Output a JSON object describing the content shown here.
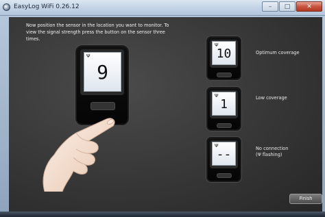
{
  "window": {
    "title": "EasyLog WiFi 0.26.12",
    "controls": {
      "minimize": "–",
      "maximize": "□",
      "close": "✕"
    }
  },
  "instructions": "Now position the sensor in the location you want to monitor. To view the signal strength press the button on the sensor three times.",
  "main_device": {
    "antenna_icon": "antenna-icon",
    "reading": "9"
  },
  "legend": [
    {
      "reading": "10",
      "label": "Optimum coverage"
    },
    {
      "reading": "1",
      "label": "Low coverage"
    },
    {
      "reading": "--",
      "label_line1": "No connection",
      "label_line2_prefix": "(",
      "label_line2_suffix": " flashing)"
    }
  ],
  "antenna_glyph": "Ψ",
  "finish_button": "Finish",
  "colors": {
    "background": "#333333",
    "text": "#f0f0f0",
    "screen": "#ffffff"
  }
}
